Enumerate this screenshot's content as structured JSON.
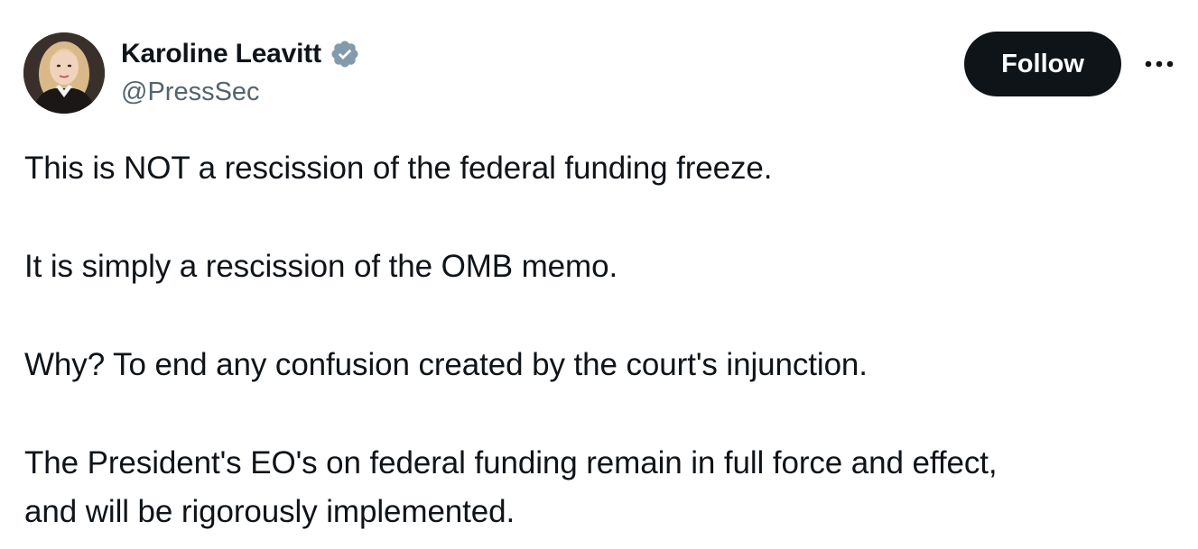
{
  "author": {
    "display_name": "Karoline Leavitt",
    "handle": "@PressSec",
    "verified": true,
    "verified_badge_color": "#829aab"
  },
  "actions": {
    "follow_label": "Follow",
    "more_icon": "more-horizontal-icon"
  },
  "tweet": {
    "paragraphs": [
      "This is NOT a rescission of the federal funding freeze.",
      "It is simply a rescission of the OMB memo.",
      "Why? To end any confusion created by the court's injunction.",
      "The President's EO's on federal funding remain in full force and effect,",
      "and will be rigorously implemented."
    ]
  },
  "colors": {
    "text_primary": "#0f1419",
    "text_secondary": "#536471",
    "follow_button_bg": "#0f1419",
    "follow_button_text": "#ffffff",
    "background": "#ffffff"
  }
}
